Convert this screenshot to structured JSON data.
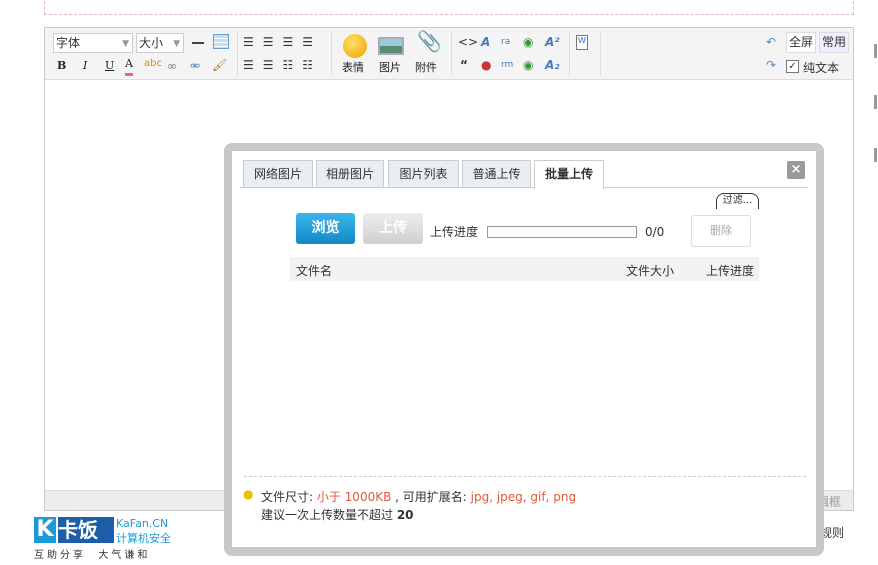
{
  "toolbar": {
    "font_select": "字体",
    "size_select": "大小",
    "emoticon_label": "表情",
    "image_label": "图片",
    "attachment_label": "附件",
    "fullscreen_label": "全屏",
    "common_label": "常用",
    "plain_text_label": "纯文本",
    "plain_text_checked": true,
    "icons": [
      "horizontal-rule",
      "table",
      "align-left",
      "align-center",
      "align-center-2",
      "align-right",
      "bold",
      "italic",
      "underline",
      "font-color",
      "highlight",
      "link",
      "unlink",
      "format-brush",
      "float-left",
      "float-right",
      "ordered-list",
      "unordered-list",
      "emoticon",
      "image",
      "paperclip",
      "code",
      "font-style",
      "real-audio",
      "flash",
      "superscript",
      "quote",
      "qq",
      "rm-video",
      "media",
      "subscript",
      "word-paste",
      "undo",
      "redo"
    ]
  },
  "bottom_bar": {
    "resize_label": "编辑框"
  },
  "dialog": {
    "tabs": [
      {
        "label": "网络图片",
        "active": false
      },
      {
        "label": "相册图片",
        "active": false
      },
      {
        "label": "图片列表",
        "active": false
      },
      {
        "label": "普通上传",
        "active": false
      },
      {
        "label": "批量上传",
        "active": true
      }
    ],
    "filter_label": "过滤...",
    "browse_label": "浏览",
    "upload_label": "上传",
    "progress_label": "上传进度",
    "progress_value": 0,
    "progress_count": "0/0",
    "delete_label": "删除",
    "columns": [
      "文件名",
      "文件大小",
      "上传进度"
    ],
    "info": {
      "size_prefix": "文件尺寸: ",
      "size_value": "小于 1000KB",
      "ext_prefix": " , 可用扩展名: ",
      "ext_value": "jpg, jpeg, gif, png",
      "count_text": "建议一次上传数量不超过 ",
      "count_value": "20"
    },
    "colors": {
      "accent": "#1a9bd7",
      "highlight": "#e05a3a"
    }
  },
  "footer": {
    "logo_main": "卡饭",
    "logo_site": "KaFan.CN",
    "logo_sub": "计算机安全",
    "logo_slogan": "互助分享  大气谦和",
    "rules_text": "分规则"
  }
}
